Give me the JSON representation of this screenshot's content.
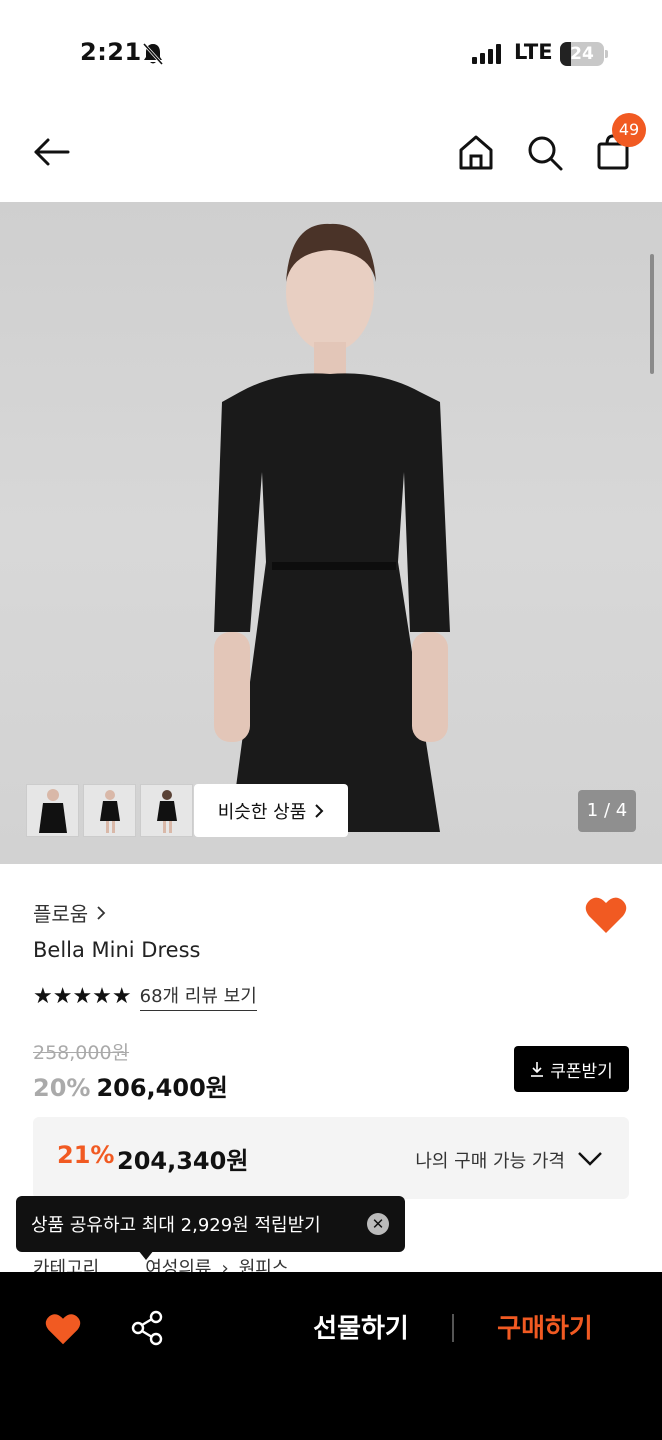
{
  "status_bar": {
    "time": "2:21",
    "network": "LTE",
    "battery": "24",
    "battery_level_percent": 24
  },
  "header": {
    "cart_count": "49",
    "icons": [
      "back-arrow-icon",
      "home-icon",
      "search-icon",
      "cart-icon"
    ]
  },
  "gallery": {
    "similar_label": "비슷한 상품",
    "page_indicator": "1 / 4"
  },
  "product": {
    "brand": "플로움",
    "name": "Bella Mini Dress",
    "stars": "★★★★★",
    "review_link": "68개 리뷰 보기",
    "original_price": "258,000원",
    "discount": "20%",
    "price": "206,400원",
    "coupon_label": "쿠폰받기",
    "my_price": {
      "discount": "21%",
      "price": "204,340원",
      "label": "나의 구매 가능 가격"
    }
  },
  "tooltip": {
    "text": "상품 공유하고 최대 2,929원 적립받기"
  },
  "category": {
    "label": "카테고리",
    "path_1": "여성의류",
    "path_2": "원피스"
  },
  "bottom_bar": {
    "gift_label": "선물하기",
    "buy_label": "구매하기"
  },
  "colors": {
    "accent": "#f15a22",
    "dark": "#000000"
  }
}
